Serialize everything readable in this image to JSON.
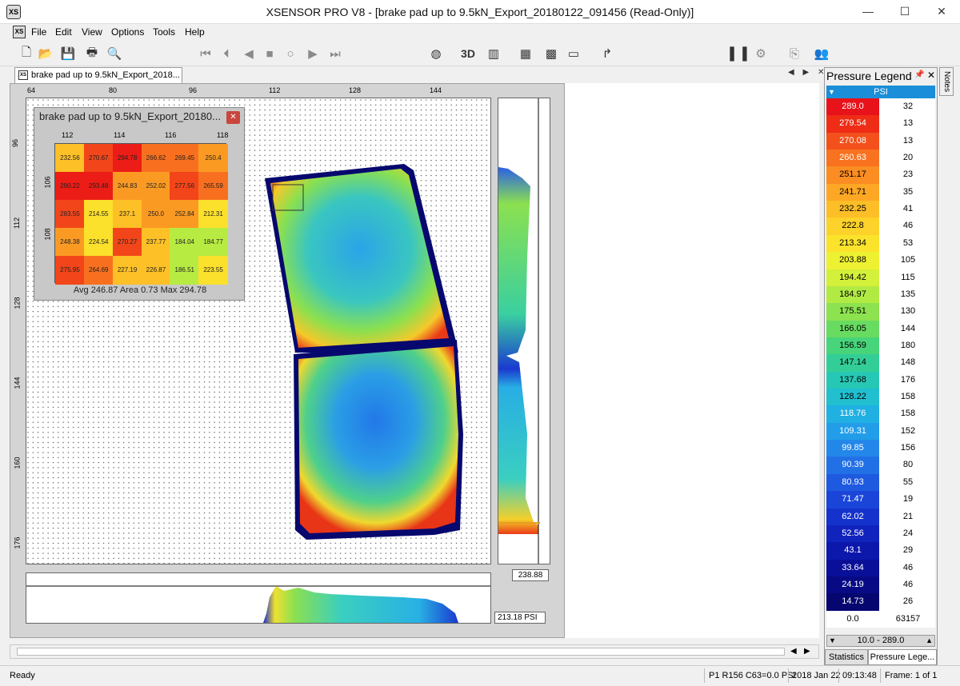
{
  "window": {
    "title": "XSENSOR PRO V8 - [brake pad up to 9.5kN_Export_20180122_091456 (Read-Only)]",
    "icon": "xsensor-logo-icon",
    "controls": [
      "—",
      "☐",
      "✕"
    ]
  },
  "menu": [
    "File",
    "Edit",
    "View",
    "Options",
    "Tools",
    "Help"
  ],
  "toolbar": [
    {
      "name": "new-file-icon",
      "glyph": "🗋"
    },
    {
      "name": "open-folder-icon",
      "glyph": "📂"
    },
    {
      "name": "save-icon",
      "glyph": "💾"
    },
    {
      "name": "print-icon",
      "glyph": "🖶"
    },
    {
      "name": "print-preview-icon",
      "glyph": "🔍"
    },
    {
      "name": "first-frame-icon",
      "glyph": "⏮"
    },
    {
      "name": "step-back-icon",
      "glyph": "⏴"
    },
    {
      "name": "play-back-icon",
      "glyph": "◀"
    },
    {
      "name": "stop-icon",
      "glyph": "■"
    },
    {
      "name": "record-icon",
      "glyph": "○"
    },
    {
      "name": "play-icon",
      "glyph": "▶"
    },
    {
      "name": "last-frame-icon",
      "glyph": "⏭"
    },
    {
      "name": "color-contour-icon",
      "glyph": "◍"
    },
    {
      "name": "3d-view-button",
      "glyph": "3D"
    },
    {
      "name": "bar-graph-icon",
      "glyph": "▥"
    },
    {
      "name": "grid-view-icon",
      "glyph": "▦"
    },
    {
      "name": "tiles-view-icon",
      "glyph": "▩"
    },
    {
      "name": "film-strip-icon",
      "glyph": "▭"
    },
    {
      "name": "pointer-arrow-icon",
      "glyph": "↱"
    },
    {
      "name": "compare-icon",
      "glyph": "▌▐"
    },
    {
      "name": "calibrate-icon",
      "glyph": "⚙"
    },
    {
      "name": "export-icon",
      "glyph": "⎘"
    },
    {
      "name": "users-icon",
      "glyph": "👥"
    }
  ],
  "doc_tab": {
    "label": "brake pad up to 9.5kN_Export_2018..."
  },
  "tab_nav": "◀ ▶ ✕",
  "ruler_top": [
    "64",
    "80",
    "96",
    "112",
    "128",
    "144"
  ],
  "ruler_left": [
    "96",
    "112",
    "128",
    "144",
    "160",
    "176"
  ],
  "popup": {
    "title": "brake pad up to 9.5kN_Export_20180...",
    "close": "✕",
    "col_labels": [
      "112",
      "114",
      "116",
      "118"
    ],
    "row_labels": [
      "106",
      "108"
    ],
    "values": [
      [
        "232.56",
        "270.67",
        "294.78",
        "266.62",
        "269.45",
        "250.4"
      ],
      [
        "290.22",
        "293.48",
        "244.83",
        "252.02",
        "277.56",
        "265.59"
      ],
      [
        "283.55",
        "214.55",
        "237.1",
        "250.0",
        "252.84",
        "212.31"
      ],
      [
        "248.38",
        "224.54",
        "270.27",
        "237.77",
        "184.04",
        "184.77"
      ],
      [
        "275.95",
        "264.69",
        "227.19",
        "226.87",
        "186.51",
        "223.55"
      ]
    ],
    "footer": "Avg 246.87 Area 0.73 Max 294.78"
  },
  "side_profile_value": "238.88",
  "bottom_profile_value": "213.18 PSI",
  "legend": {
    "title": "Pressure Legend",
    "pin": "📌",
    "unit": "PSI",
    "rows": [
      {
        "value": "289.0",
        "count": "32",
        "color": "#e8121a"
      },
      {
        "value": "279.54",
        "count": "13",
        "color": "#ef2c15"
      },
      {
        "value": "270.08",
        "count": "13",
        "color": "#f4501b"
      },
      {
        "value": "260.63",
        "count": "20",
        "color": "#f87220"
      },
      {
        "value": "251.17",
        "count": "23",
        "color": "#fb8d22"
      },
      {
        "value": "241.71",
        "count": "35",
        "color": "#fda724"
      },
      {
        "value": "232.25",
        "count": "41",
        "color": "#fdbe27"
      },
      {
        "value": "222.8",
        "count": "46",
        "color": "#fdd22a"
      },
      {
        "value": "213.34",
        "count": "53",
        "color": "#fbe32c"
      },
      {
        "value": "203.88",
        "count": "105",
        "color": "#eef132"
      },
      {
        "value": "194.42",
        "count": "115",
        "color": "#d3f03a"
      },
      {
        "value": "184.97",
        "count": "135",
        "color": "#b1ea43"
      },
      {
        "value": "175.51",
        "count": "130",
        "color": "#8ce24f"
      },
      {
        "value": "166.05",
        "count": "144",
        "color": "#68db61"
      },
      {
        "value": "156.59",
        "count": "180",
        "color": "#48d47a"
      },
      {
        "value": "147.14",
        "count": "148",
        "color": "#33ce97"
      },
      {
        "value": "137.68",
        "count": "176",
        "color": "#26c8b5"
      },
      {
        "value": "128.22",
        "count": "158",
        "color": "#21bfd0"
      },
      {
        "value": "118.76",
        "count": "158",
        "color": "#20b0e2"
      },
      {
        "value": "109.31",
        "count": "152",
        "color": "#229de9"
      },
      {
        "value": "99.85",
        "count": "156",
        "color": "#2387ea"
      },
      {
        "value": "90.39",
        "count": "80",
        "color": "#2270e6"
      },
      {
        "value": "80.93",
        "count": "55",
        "color": "#1e5ae0"
      },
      {
        "value": "71.47",
        "count": "19",
        "color": "#1a45d8"
      },
      {
        "value": "62.02",
        "count": "21",
        "color": "#1533cc"
      },
      {
        "value": "52.56",
        "count": "24",
        "color": "#1023bd"
      },
      {
        "value": "43.1",
        "count": "29",
        "color": "#0c17ab"
      },
      {
        "value": "33.64",
        "count": "46",
        "color": "#090f98"
      },
      {
        "value": "24.19",
        "count": "46",
        "color": "#070a84"
      },
      {
        "value": "14.73",
        "count": "26",
        "color": "#05066f"
      },
      {
        "value": "0.0",
        "count": "63157",
        "color": "#ffffff"
      }
    ],
    "range": "10.0 - 289.0",
    "tabs": [
      "Statistics",
      "Pressure Lege..."
    ]
  },
  "notes_tab": "Notes",
  "status": {
    "ready": "Ready",
    "position": "P1 R156 C63=0.0 PSI",
    "date": "2018 Jan 22",
    "time": "09:13:48",
    "frame": "Frame: 1 of 1"
  }
}
